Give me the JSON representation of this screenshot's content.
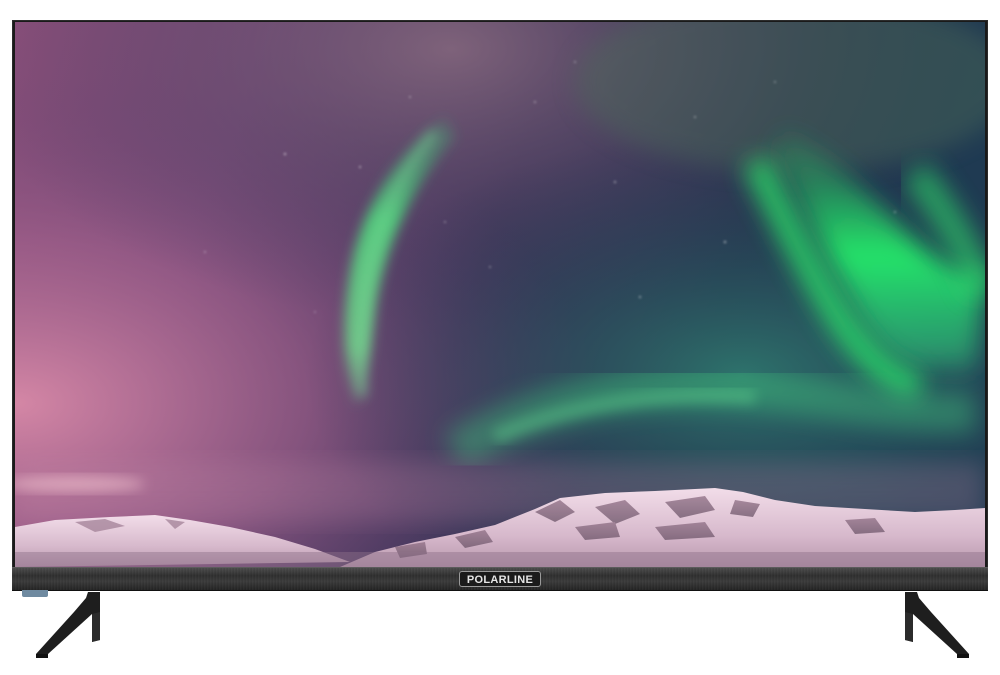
{
  "product": {
    "brand_logo": "POLARLINE"
  },
  "scene": {
    "subject": "aurora-borealis-over-snowy-mountains",
    "colors": {
      "sky_top": "#3b2d4e",
      "sky_pink": "#b86a8f",
      "aurora_green": "#2fe36a",
      "snow": "#e8d4e2",
      "bezel": "#1a1a1a",
      "ir_sensor": "#6f8aa0"
    }
  }
}
